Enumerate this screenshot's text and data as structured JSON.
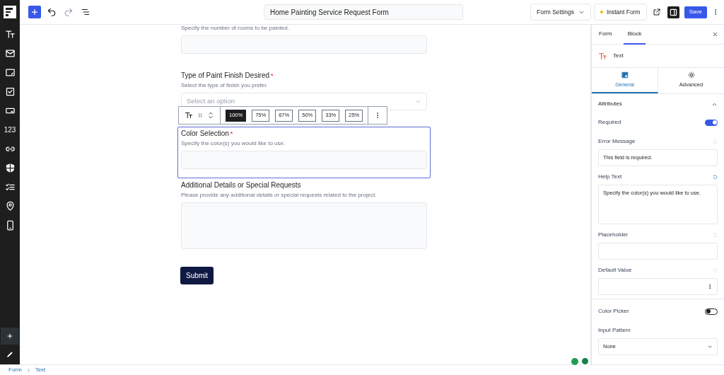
{
  "header": {
    "form_title": "Home Painting Service Request Form",
    "form_settings": "Form Settings",
    "instant_form": "Instant Form",
    "save": "Save"
  },
  "sidebar": {
    "tools": [
      {
        "kind": "text-size"
      },
      {
        "kind": "mail"
      },
      {
        "kind": "textarea"
      },
      {
        "kind": "checkbox"
      },
      {
        "kind": "dropdown"
      },
      {
        "kind": "number",
        "label": "123"
      },
      {
        "kind": "link"
      },
      {
        "kind": "shield"
      },
      {
        "kind": "checklist"
      },
      {
        "kind": "pin"
      },
      {
        "kind": "phone"
      }
    ]
  },
  "form": {
    "fields": [
      {
        "kind": "input",
        "help": "Specify the number of rooms to be painted.",
        "selected": false
      },
      {
        "kind": "select",
        "label": "Type of Paint Finish Desired",
        "required": true,
        "help": "Select the type of finish you prefer.",
        "placeholder": "Select an option",
        "selected": false
      },
      {
        "kind": "input",
        "label": "Color Selection",
        "required": true,
        "help": "Specify the color(s) you would like to use.",
        "selected": true
      },
      {
        "kind": "textarea",
        "label": "Additional Details or Special Requests",
        "required": false,
        "help": "Please provide any additional details or special requests related to the project.",
        "selected": false
      }
    ],
    "required_marker": "*",
    "submit": "Submit"
  },
  "block_toolbar": {
    "widths": [
      {
        "label": "100%",
        "selected": true
      },
      {
        "label": "75%",
        "selected": false
      },
      {
        "label": "67%",
        "selected": false
      },
      {
        "label": "50%",
        "selected": false
      },
      {
        "label": "33%",
        "selected": false
      },
      {
        "label": "25%",
        "selected": false
      }
    ]
  },
  "panel": {
    "tabs": [
      {
        "label": "Form",
        "selected": false
      },
      {
        "label": "Block",
        "selected": true
      }
    ],
    "block_name": "Text",
    "subtabs": [
      {
        "label": "General",
        "kind": "general",
        "selected": true
      },
      {
        "label": "Advanced",
        "kind": "advanced",
        "selected": false
      }
    ],
    "section": {
      "title": "Attributes",
      "expanded": true
    },
    "settings": [
      {
        "kind": "toggle",
        "label": "Required",
        "on": true
      },
      {
        "kind": "input",
        "label": "Error Message",
        "value": "This field is required.",
        "modified": false
      },
      {
        "kind": "textarea",
        "label": "Help Text",
        "value": "Specify the color(s) you would like to use.",
        "modified": true
      },
      {
        "kind": "input",
        "label": "Placeholder",
        "modified": false
      },
      {
        "kind": "input-menu",
        "label": "Default Value",
        "modified": false
      },
      {
        "kind": "divider"
      },
      {
        "kind": "toggle",
        "label": "Color Picker",
        "on": false
      },
      {
        "kind": "select",
        "label": "Input Pattern",
        "value": "None"
      }
    ]
  },
  "breadcrumb": [
    "Form",
    "Text"
  ]
}
